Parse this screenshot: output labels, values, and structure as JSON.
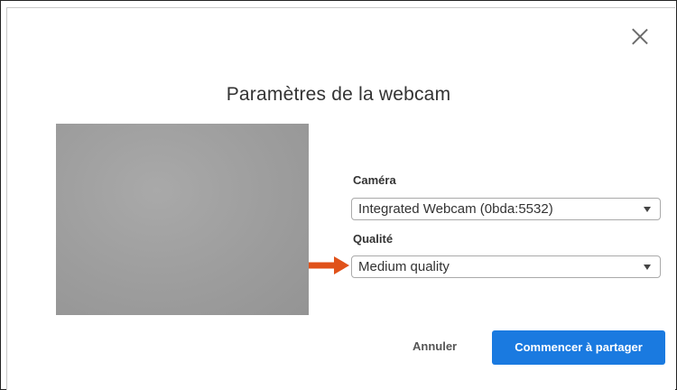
{
  "dialog": {
    "title": "Paramètres de la webcam",
    "close_icon": "close-icon"
  },
  "camera": {
    "label": "Caméra",
    "selected": "Integrated Webcam (0bda:5532)"
  },
  "quality": {
    "label": "Qualité",
    "selected": "Medium quality"
  },
  "annotation": {
    "arrow_icon": "arrow-right-icon",
    "color": "#e0521a"
  },
  "buttons": {
    "cancel": "Annuler",
    "start": "Commencer à partager"
  },
  "colors": {
    "primary": "#1a7ae0"
  }
}
